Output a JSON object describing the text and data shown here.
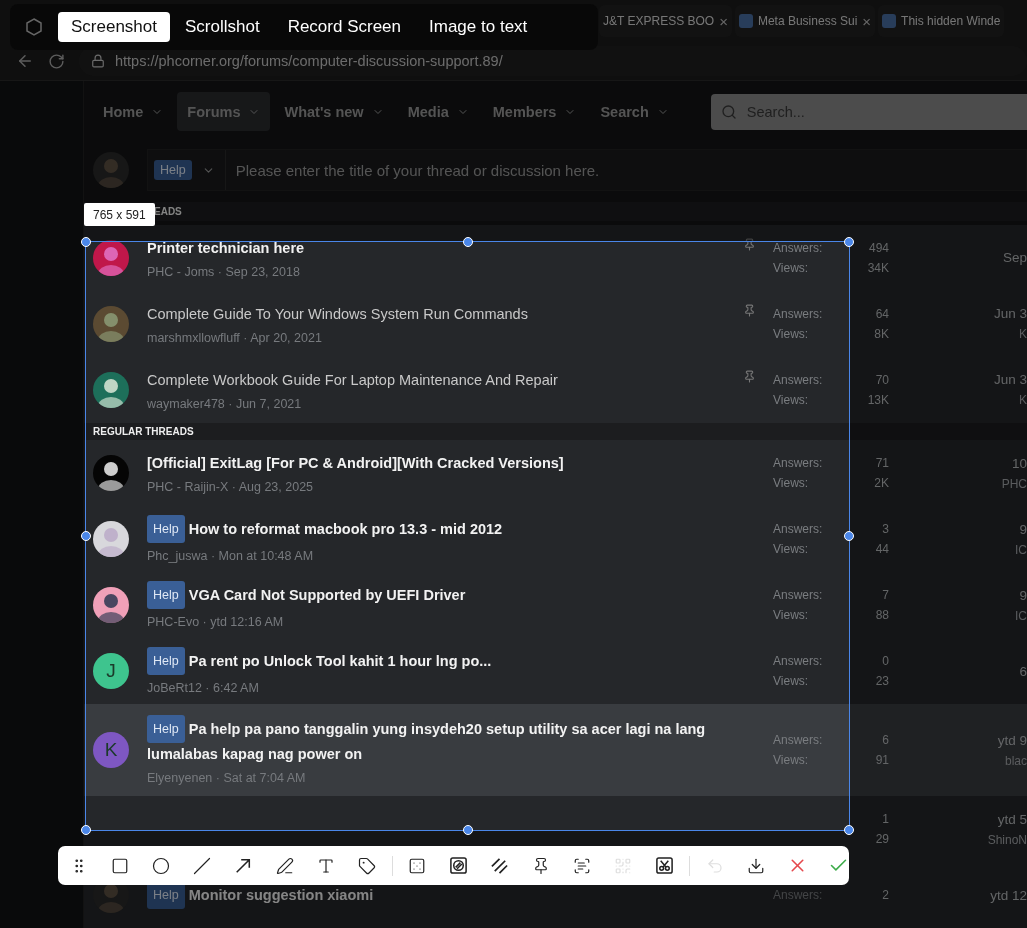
{
  "capture_modes": [
    {
      "label": "Screenshot",
      "selected": true
    },
    {
      "label": "Scrollshot",
      "selected": false
    },
    {
      "label": "Record Screen",
      "selected": false
    },
    {
      "label": "Image to text",
      "selected": false
    }
  ],
  "browser_tabs": [
    {
      "title": "J&T EXPRESS BOO",
      "favicon": false,
      "close": "×"
    },
    {
      "title": "Meta Business Sui",
      "favicon": true,
      "close": "×"
    },
    {
      "title": "This hidden Winde",
      "favicon": true
    }
  ],
  "address_bar": {
    "url": "https://phcorner.org/forums/computer-discussion-support.89/"
  },
  "nav": [
    {
      "label": "Home",
      "selected": false
    },
    {
      "label": "Forums",
      "selected": true
    },
    {
      "label": "What's new",
      "selected": false
    },
    {
      "label": "Media",
      "selected": false
    },
    {
      "label": "Members",
      "selected": false
    },
    {
      "label": "Search",
      "selected": false
    }
  ],
  "search": {
    "placeholder": "Search..."
  },
  "composer": {
    "prefix": "Help",
    "placeholder": "Please enter the title of your thread or discussion here."
  },
  "selection": {
    "size": "765 x 591"
  },
  "sections": [
    {
      "title": "EADS",
      "threads": [
        {
          "title": "Printer technician here",
          "meta": "PHC - Joms · Sep 23, 2018",
          "unread": true,
          "pinned": true,
          "highlighted": false,
          "answers_label": "Answers:",
          "answers": "494",
          "views_label": "Views:",
          "views": "34K",
          "last_date": "Sep"
        },
        {
          "title": "Complete Guide To Your Windows System Run Commands",
          "meta": "marshmxllowfluff · Apr 20, 2021",
          "unread": false,
          "pinned": true,
          "highlighted": false,
          "answers_label": "Answers:",
          "answers": "64",
          "views_label": "Views:",
          "views": "8K",
          "last_date": "Jun 3",
          "last_user": "K"
        },
        {
          "title": "Complete Workbook Guide For Laptop Maintenance And Repair",
          "meta": "waymaker478 · Jun 7, 2021",
          "unread": false,
          "pinned": true,
          "highlighted": false,
          "answers_label": "Answers:",
          "answers": "70",
          "views_label": "Views:",
          "views": "13K",
          "last_date": "Jun 3",
          "last_user": "K"
        }
      ]
    },
    {
      "title": "REGULAR THREADS",
      "threads": [
        {
          "title": "[Official] ExitLag [For PC & Android][With Cracked Versions]",
          "meta": "PHC - Raijin-X · Aug 23, 2025",
          "unread": true,
          "pinned": false,
          "highlighted": false,
          "answers_label": "Answers:",
          "answers": "71",
          "views_label": "Views:",
          "views": "2K",
          "last_date": "10",
          "last_user": "PHC"
        },
        {
          "prefix": "Help",
          "title": "How to reformat macbook pro 13.3 - mid 2012",
          "meta": "Phc_juswa · Mon at 10:48 AM",
          "unread": true,
          "pinned": false,
          "highlighted": false,
          "answers_label": "Answers:",
          "answers": "3",
          "views_label": "Views:",
          "views": "44",
          "last_date": "9",
          "last_user": "IC"
        },
        {
          "prefix": "Help",
          "title": "VGA Card Not Supported by UEFI Driver",
          "meta": "PHC-Evo · ytd 12:16 AM",
          "unread": true,
          "pinned": false,
          "highlighted": false,
          "answers_label": "Answers:",
          "answers": "7",
          "views_label": "Views:",
          "views": "88",
          "last_date": "9",
          "last_user": "IC"
        },
        {
          "prefix": "Help",
          "title": "Pa rent po Unlock Tool kahit 1 hour lng po...",
          "meta": "JoBeRt12 · 6:42 AM",
          "unread": true,
          "pinned": false,
          "highlighted": false,
          "avatar": {
            "kind": "letter",
            "letter": "J",
            "color": "#3ec48e"
          },
          "answers_label": "Answers:",
          "answers": "0",
          "views_label": "Views:",
          "views": "23",
          "last_date": "6"
        },
        {
          "prefix": "Help",
          "title": "Pa help pa pano tanggalin yung insydeh20 setup utility sa acer lagi na lang lumalabas kapag nag power on",
          "meta": "Elyenyenen · Sat at 7:04 AM",
          "unread": true,
          "pinned": false,
          "highlighted": true,
          "avatar": {
            "kind": "letter",
            "letter": "K",
            "color": "#7e57c2"
          },
          "answers_label": "Answers:",
          "answers": "6",
          "views_label": "Views:",
          "views": "91",
          "last_date": "ytd 9",
          "last_user": "blac"
        },
        {
          "answers": "1",
          "views": "29",
          "pinned": false,
          "highlighted": false,
          "avatar": {
            "kind": "hidden"
          },
          "last_date": "ytd 5",
          "last_user": "ShinoN"
        },
        {
          "prefix": "Help",
          "title": "Monitor suggestion xiaomi",
          "unread": true,
          "pinned": false,
          "highlighted": false,
          "answers_label": "Answers:",
          "answers": "2",
          "last_date": "ytd 12"
        }
      ]
    }
  ],
  "toolbar": [
    {
      "kind": "grip",
      "disabled": false
    },
    {
      "kind": "rectangle",
      "disabled": false
    },
    {
      "kind": "ellipse",
      "disabled": false
    },
    {
      "kind": "line",
      "disabled": false
    },
    {
      "kind": "arrow",
      "disabled": false
    },
    {
      "kind": "pen",
      "disabled": false
    },
    {
      "kind": "text",
      "disabled": false
    },
    {
      "kind": "tag",
      "disabled": false
    },
    {
      "kind": "divider",
      "disabled": false
    },
    {
      "kind": "mosaic",
      "disabled": false
    },
    {
      "kind": "blur",
      "disabled": false
    },
    {
      "kind": "hatch",
      "disabled": false
    },
    {
      "kind": "pin",
      "disabled": false
    },
    {
      "kind": "ocr",
      "disabled": false
    },
    {
      "kind": "qr",
      "disabled": true
    },
    {
      "kind": "cutout",
      "disabled": false
    },
    {
      "kind": "divider",
      "disabled": false
    },
    {
      "kind": "undo",
      "disabled": true
    },
    {
      "kind": "download",
      "disabled": false
    },
    {
      "kind": "cancel",
      "disabled": false
    },
    {
      "kind": "confirm",
      "disabled": false
    }
  ]
}
